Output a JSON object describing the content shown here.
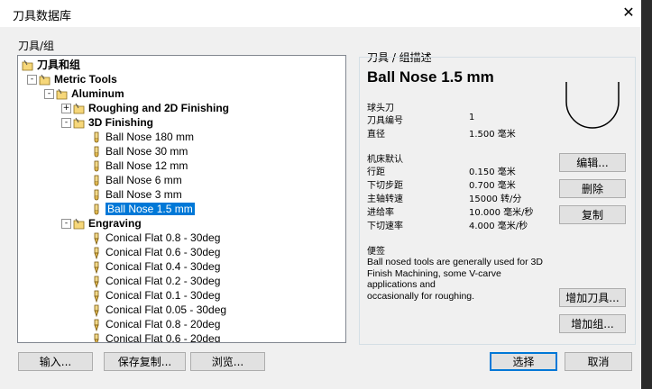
{
  "window": {
    "title": "刀具数据库",
    "close": "✕"
  },
  "tree": {
    "label": "刀具/组",
    "rows": [
      {
        "text": "刀具和组",
        "bold": true,
        "icon": "folder"
      },
      {
        "text": "Metric Tools",
        "bold": true,
        "icon": "folder",
        "exp": "-"
      },
      {
        "text": "Aluminum",
        "bold": true,
        "icon": "folder",
        "exp": "-"
      },
      {
        "text": "Roughing and 2D Finishing",
        "bold": true,
        "icon": "folder",
        "exp": "+"
      },
      {
        "text": "3D Finishing",
        "bold": true,
        "icon": "folder",
        "exp": "-"
      },
      {
        "text": "Ball Nose 180 mm",
        "bold": false,
        "icon": "ballnose"
      },
      {
        "text": "Ball Nose 30 mm",
        "bold": false,
        "icon": "ballnose"
      },
      {
        "text": "Ball Nose 12 mm",
        "bold": false,
        "icon": "ballnose"
      },
      {
        "text": "Ball Nose 6 mm",
        "bold": false,
        "icon": "ballnose"
      },
      {
        "text": "Ball Nose 3 mm",
        "bold": false,
        "icon": "ballnose"
      },
      {
        "text": "Ball Nose 1.5 mm",
        "bold": false,
        "icon": "ballnose",
        "selected": true
      },
      {
        "text": "Engraving",
        "bold": true,
        "icon": "folder",
        "exp": "-"
      },
      {
        "text": "Conical Flat 0.8 - 30deg",
        "bold": false,
        "icon": "conical"
      },
      {
        "text": "Conical Flat 0.6 - 30deg",
        "bold": false,
        "icon": "conical"
      },
      {
        "text": "Conical Flat 0.4 - 30deg",
        "bold": false,
        "icon": "conical"
      },
      {
        "text": "Conical Flat 0.2 - 30deg",
        "bold": false,
        "icon": "conical"
      },
      {
        "text": "Conical Flat 0.1 - 30deg",
        "bold": false,
        "icon": "conical"
      },
      {
        "text": "Conical Flat 0.05 - 30deg",
        "bold": false,
        "icon": "conical"
      },
      {
        "text": "Conical Flat 0.8 - 20deg",
        "bold": false,
        "icon": "conical"
      },
      {
        "text": "Conical Flat 0.6 - 20deg",
        "bold": false,
        "icon": "conical"
      }
    ]
  },
  "desc": {
    "label": "刀具 / 组描述",
    "title": "Ball Nose 1.5 mm",
    "tool_type": "球头刀",
    "props1": [
      {
        "k": "刀具编号",
        "v": "1"
      },
      {
        "k": "直径",
        "v": "1.500 毫米"
      }
    ],
    "defaults_label": "机床默认",
    "props2": [
      {
        "k": "行距",
        "v": "0.150 毫米"
      },
      {
        "k": "下切步距",
        "v": "0.700 毫米"
      },
      {
        "k": "主轴转速",
        "v": "15000 转/分"
      },
      {
        "k": "进给率",
        "v": "10.000 毫米/秒"
      },
      {
        "k": "下切速率",
        "v": "4.000 毫米/秒"
      }
    ],
    "notes_label": "便签",
    "notes": "Ball nosed tools are generally used for 3D Finish Machining, some V-carve applications and\noccasionally for roughing."
  },
  "buttons": {
    "edit": "编辑...",
    "delete": "删除",
    "copy": "复制",
    "add_tool": "增加刀具...",
    "add_group": "增加组...",
    "import": "输入...",
    "save_copy": "保存复制...",
    "browse": "浏览...",
    "select": "选择",
    "cancel": "取消"
  }
}
